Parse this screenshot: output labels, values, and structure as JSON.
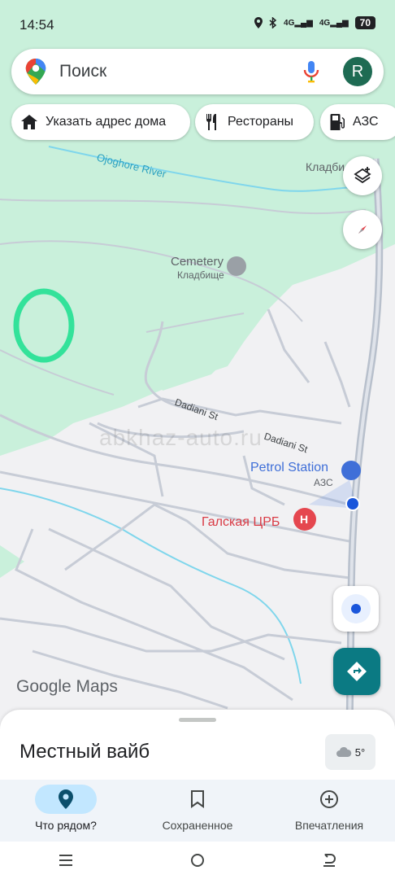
{
  "status_bar": {
    "time": "14:54",
    "net1": "4G",
    "net2": "4G",
    "battery": "70"
  },
  "search": {
    "placeholder": "Поиск",
    "avatar_letter": "R"
  },
  "chips": [
    {
      "label": "Указать адрес дома",
      "icon": "home-icon"
    },
    {
      "label": "Рестораны",
      "icon": "restaurant-icon"
    },
    {
      "label": "АЗС",
      "icon": "gas-station-icon"
    }
  ],
  "map": {
    "labels": {
      "river": "Ojoghore River",
      "cemetery": "Cemetery",
      "cemetery_local": "Кладбище",
      "cemetery_top": "Кладби",
      "street1": "Dadiani St",
      "street2": "Dadiani St",
      "petrol": "Petrol Station",
      "petrol_local": "АЗС",
      "hospital": "Галская ЦРБ",
      "hospital_badge": "H"
    },
    "watermark": "abkhaz-auto.ru",
    "attribution": "Google Maps",
    "colors": {
      "park": "#c9f0db",
      "land": "#f1f1f3",
      "road": "#c7ccd6",
      "water": "#7fd6ec",
      "highway": "#b8c0cc",
      "accent": "#0b7a83",
      "hospital": "#e5474f",
      "petrol": "#3f6fd8"
    }
  },
  "sheet": {
    "title": "Местный вайб",
    "weather": "5°"
  },
  "bottom_nav": [
    {
      "label": "Что рядом?",
      "icon": "location-pin-icon",
      "active": true
    },
    {
      "label": "Сохраненное",
      "icon": "bookmark-icon",
      "active": false
    },
    {
      "label": "Впечатления",
      "icon": "add-circle-icon",
      "active": false
    }
  ]
}
